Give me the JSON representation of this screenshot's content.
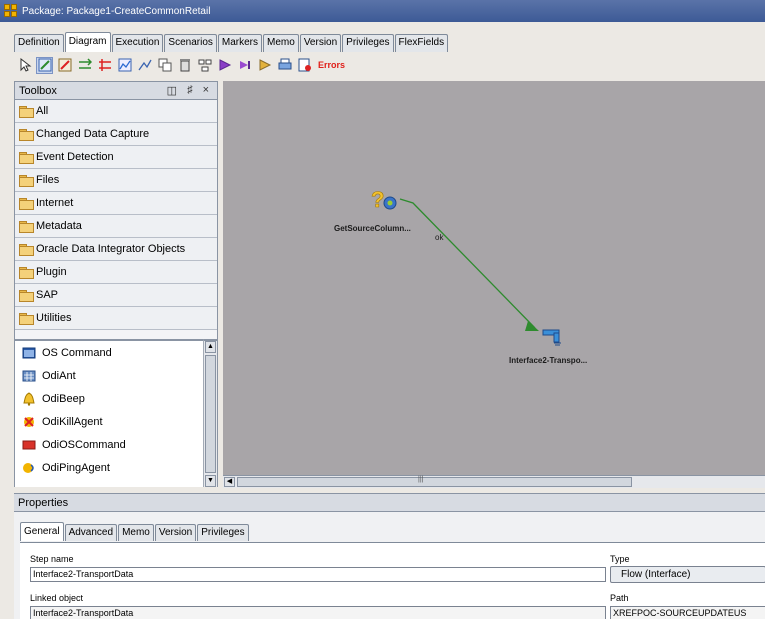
{
  "window": {
    "title": "Package: Package1-CreateCommonRetail"
  },
  "tabs": [
    {
      "label": "Definition"
    },
    {
      "label": "Diagram"
    },
    {
      "label": "Execution"
    },
    {
      "label": "Scenarios"
    },
    {
      "label": "Markers"
    },
    {
      "label": "Memo"
    },
    {
      "label": "Version"
    },
    {
      "label": "Privileges"
    },
    {
      "label": "FlexFields"
    }
  ],
  "active_tab": "Diagram",
  "toolbar": {
    "errors_label": "Errors",
    "icons": [
      "select-icon",
      "next-step-ok-icon",
      "next-step-ko-icon",
      "duplicate-icon",
      "delete-icon",
      "arrange-icon",
      "errors-icon"
    ]
  },
  "toolbox": {
    "title": "Toolbox",
    "controls": [
      "restore-icon",
      "pin-icon",
      "close-icon"
    ],
    "folders": [
      {
        "label": "All"
      },
      {
        "label": "Changed Data Capture"
      },
      {
        "label": "Event Detection"
      },
      {
        "label": "Files"
      },
      {
        "label": "Internet"
      },
      {
        "label": "Metadata"
      },
      {
        "label": "Oracle Data Integrator Objects"
      },
      {
        "label": "Plugin"
      },
      {
        "label": "SAP"
      },
      {
        "label": "Utilities"
      }
    ],
    "tools": [
      {
        "label": "OS Command"
      },
      {
        "label": "OdiAnt"
      },
      {
        "label": "OdiBeep"
      },
      {
        "label": "OdiKillAgent"
      },
      {
        "label": "OdiOSCommand"
      },
      {
        "label": "OdiPingAgent"
      }
    ]
  },
  "diagram": {
    "nodes": [
      {
        "label": "GetSourceColumn...",
        "icon": "odi-procedure-icon"
      },
      {
        "label": "Interface2-Transpo...",
        "icon": "interface-icon"
      }
    ],
    "link_label": "ok",
    "colors": {
      "canvas": "#a8a5a8",
      "ok_link": "#2e8b2e"
    }
  },
  "properties": {
    "title": "Properties",
    "tabs": [
      {
        "label": "General"
      },
      {
        "label": "Advanced"
      },
      {
        "label": "Memo"
      },
      {
        "label": "Version"
      },
      {
        "label": "Privileges"
      }
    ],
    "step_name_label": "Step name",
    "step_name_value": "Interface2-TransportData",
    "type_label": "Type",
    "type_value": "Flow (Interface)",
    "linked_object_label": "Linked object",
    "linked_object_value": "Interface2-TransportData",
    "path_label": "Path",
    "path_value": "XREFPOC-SOURCEUPDATEUS"
  }
}
